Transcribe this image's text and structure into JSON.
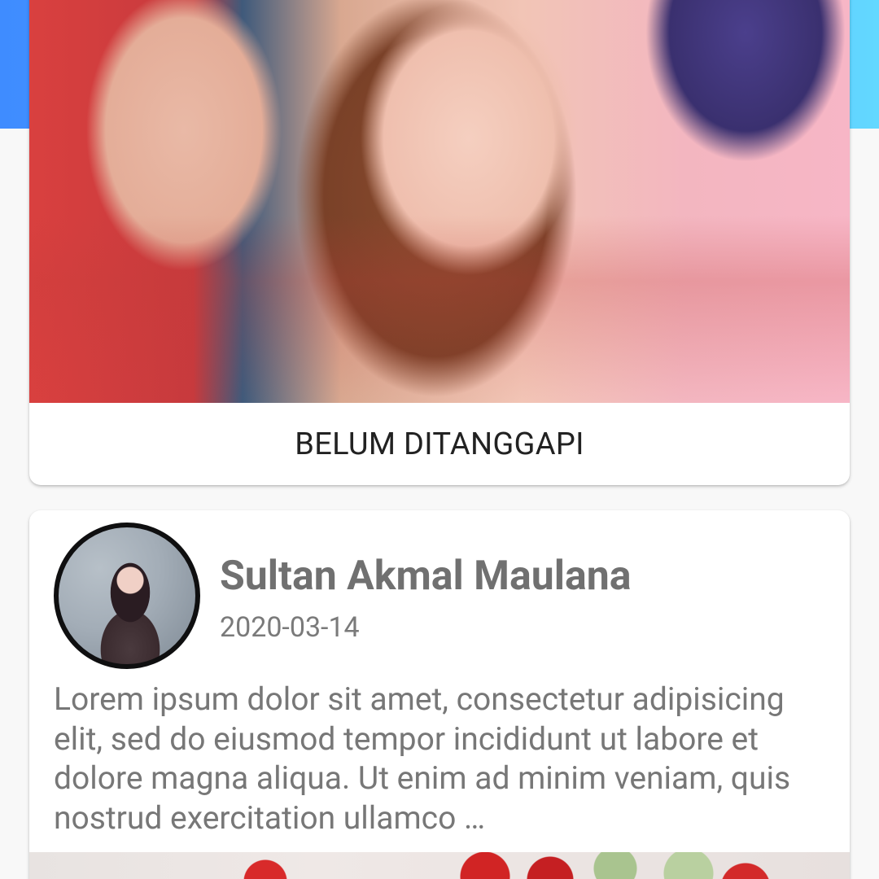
{
  "header": {
    "gradient_start": "#3f8cff",
    "gradient_end": "#63d8ff"
  },
  "cards": [
    {
      "status_label": "BELUM DITANGGAPI",
      "image_icon": "photo-icon"
    },
    {
      "author_name": "Sultan Akmal Maulana",
      "date": "2020-03-14",
      "post_text": "Lorem ipsum dolor sit amet, consectetur adipisicing elit, sed do eiusmod tempor incididunt ut labore et dolore magna aliqua. Ut enim ad minim veniam, quis nostrud exercitation ullamco …",
      "avatar_icon": "avatar",
      "image_icon": "photo-icon"
    }
  ],
  "colors": {
    "page_background": "#f8f8f8",
    "card_background": "#ffffff",
    "status_text": "#222222",
    "name_text": "#707070",
    "body_text": "#777777"
  }
}
